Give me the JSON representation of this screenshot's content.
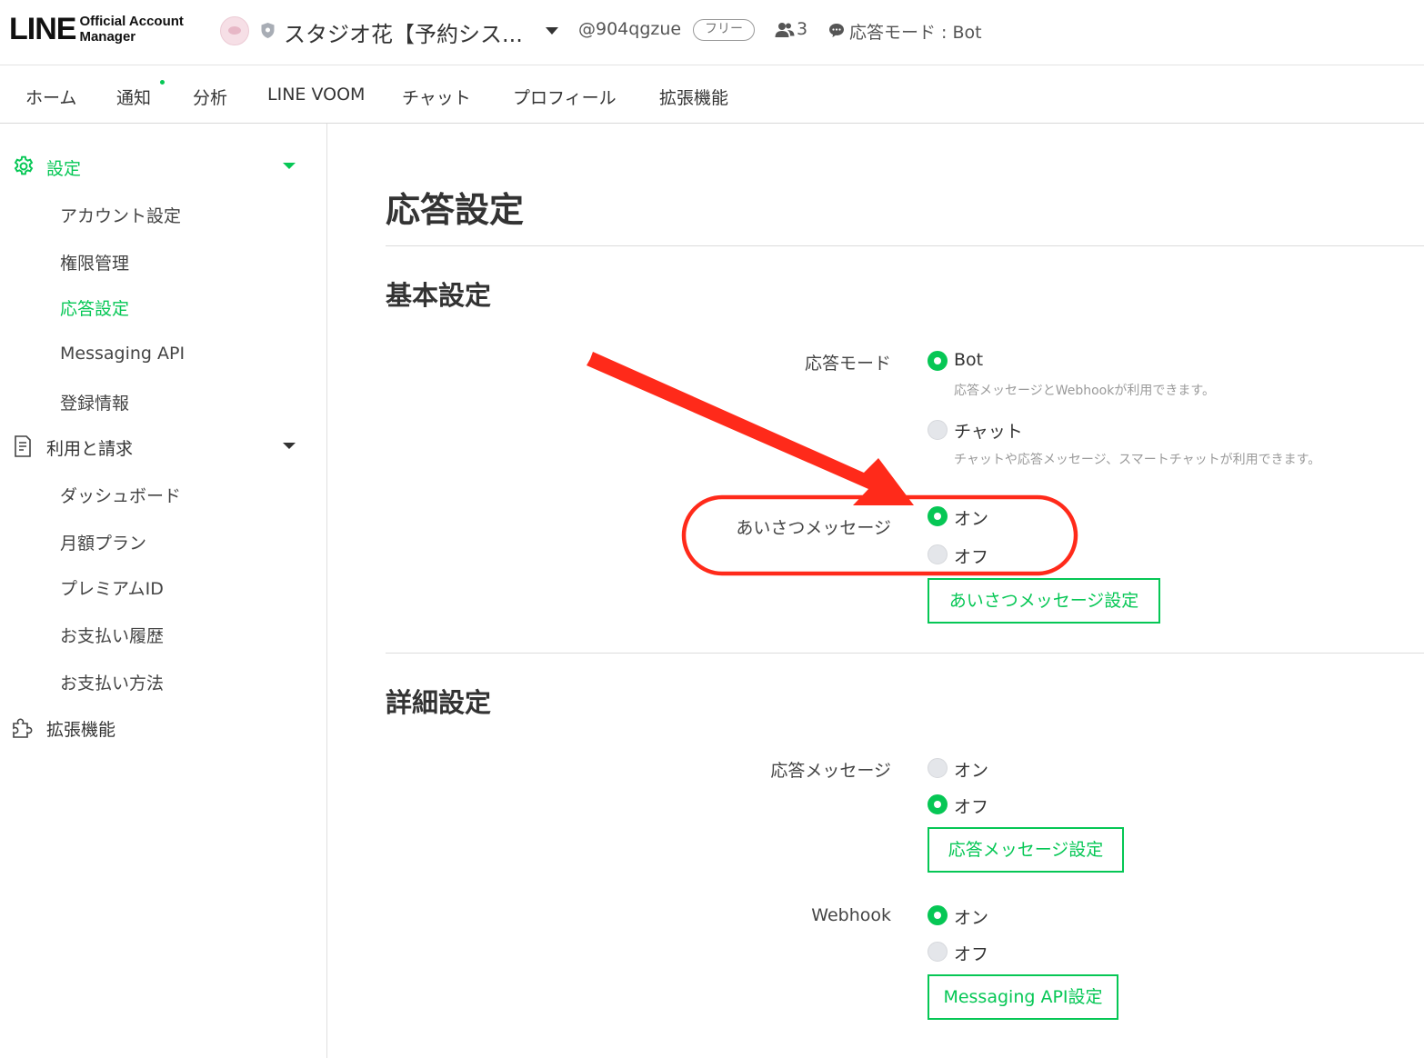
{
  "header": {
    "logo_main": "LINE",
    "logo_sub_1": "Official Account",
    "logo_sub_2": "Manager",
    "account_name": "スタジオ花【予約シス...",
    "account_id": "@904qgzue",
    "plan_badge": "フリー",
    "friends_count": "3",
    "chat_mode": "応答モード : Bot"
  },
  "nav": {
    "items": [
      "ホーム",
      "通知",
      "分析",
      "LINE VOOM",
      "チャット",
      "プロフィール",
      "拡張機能"
    ]
  },
  "sidebar": {
    "settings_label": "設定",
    "settings_items": [
      "アカウント設定",
      "権限管理",
      "応答設定",
      "Messaging API",
      "登録情報"
    ],
    "billing_label": "利用と請求",
    "billing_items": [
      "ダッシュボード",
      "月額プラン",
      "プレミアムID",
      "お支払い履歴",
      "お支払い方法"
    ],
    "extensions_label": "拡張機能",
    "active_item": "応答設定"
  },
  "main": {
    "page_title": "応答設定",
    "basic": {
      "title": "基本設定",
      "response_mode": {
        "label": "応答モード",
        "options": [
          {
            "label": "Bot",
            "desc": "応答メッセージとWebhookが利用できます。",
            "selected": true
          },
          {
            "label": "チャット",
            "desc": "チャットや応答メッセージ、スマートチャットが利用できます。",
            "selected": false
          }
        ]
      },
      "greeting": {
        "label": "あいさつメッセージ",
        "on_label": "オン",
        "off_label": "オフ",
        "value": "オン",
        "button": "あいさつメッセージ設定"
      }
    },
    "advanced": {
      "title": "詳細設定",
      "auto_reply": {
        "label": "応答メッセージ",
        "on_label": "オン",
        "off_label": "オフ",
        "value": "オフ",
        "button": "応答メッセージ設定"
      },
      "webhook": {
        "label": "Webhook",
        "on_label": "オン",
        "off_label": "オフ",
        "value": "オン",
        "button": "Messaging API設定"
      }
    }
  },
  "colors": {
    "accent": "#06c755",
    "annotation": "#ff2a1a"
  }
}
